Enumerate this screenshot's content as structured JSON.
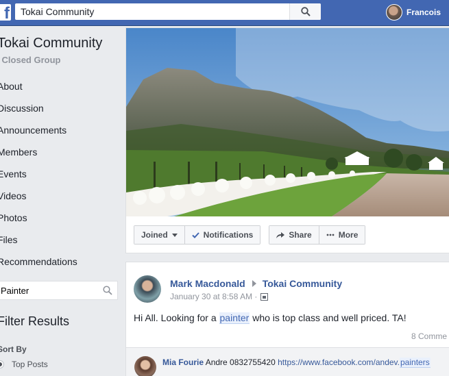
{
  "topbar": {
    "logo": "f",
    "search_value": "Tokai Community",
    "profile_name": "Francois"
  },
  "sidebar": {
    "group_name": "Tokai Community",
    "group_type": "Closed Group",
    "items": [
      {
        "label": "About"
      },
      {
        "label": "Discussion"
      },
      {
        "label": "Announcements"
      },
      {
        "label": "Members"
      },
      {
        "label": "Events"
      },
      {
        "label": "Videos"
      },
      {
        "label": "Photos"
      },
      {
        "label": "Files"
      },
      {
        "label": "Recommendations"
      }
    ],
    "search_value": "Painter",
    "filter_title": "Filter Results",
    "sort_by_label": "Sort By",
    "sort_option": "Top Posts"
  },
  "actions": {
    "joined": "Joined",
    "notifications": "Notifications",
    "share": "Share",
    "more": "More"
  },
  "post": {
    "author": "Mark Macdonald",
    "group": "Tokai Community",
    "time": "January 30 at 8:58 AM ·",
    "body_before": "Hi All. Looking for a ",
    "body_highlight": "painter",
    "body_after": " who is top class and well priced. TA!",
    "comment_count": "8 Comme",
    "comment": {
      "author": "Mia Fourie",
      "text": " Andre 0832755420 ",
      "link_before": "https://www.facebook.com/andev.",
      "link_highlight": "painters"
    }
  },
  "colors": {
    "brand": "#4267b2",
    "link": "#365899",
    "background": "#e9ebee"
  }
}
